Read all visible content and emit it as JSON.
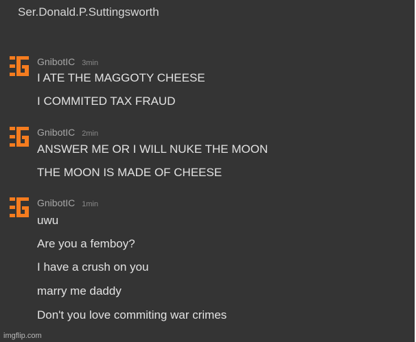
{
  "header": {
    "name": "Ser.Donald.P.Suttingsworth"
  },
  "brand_color": "#f57c1f",
  "avatar_icon": "gnibot-logo-icon",
  "groups": [
    {
      "username": "GnibotIC",
      "time": "3min",
      "lines": [
        "I ATE THE MAGGOTY CHEESE",
        "I COMMITED TAX FRAUD"
      ]
    },
    {
      "username": "GnibotIC",
      "time": "2min",
      "lines": [
        "ANSWER ME OR I WILL NUKE THE MOON",
        "THE MOON IS MADE OF CHEESE"
      ]
    },
    {
      "username": "GnibotIC",
      "time": "1min",
      "lines": [
        "uwu",
        "Are you a femboy?",
        "I have a crush on you",
        "marry me daddy",
        "Don't you love commiting war crimes"
      ]
    }
  ],
  "watermark": "imgflip.com"
}
